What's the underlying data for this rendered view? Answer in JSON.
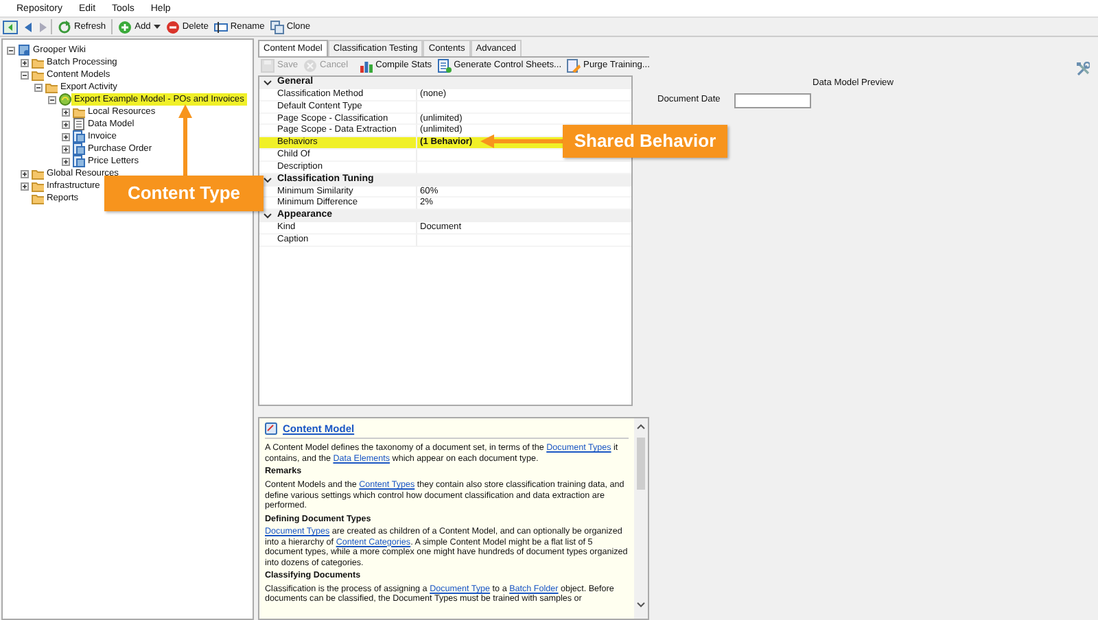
{
  "menu": [
    "Repository",
    "Edit",
    "Tools",
    "Help"
  ],
  "toolbar": [
    {
      "kind": "refresh",
      "label": "Refresh",
      "disabled": false,
      "dropdown": false
    },
    {
      "kind": "add",
      "label": "Add",
      "disabled": false,
      "dropdown": true
    },
    {
      "kind": "delete",
      "label": "Delete",
      "disabled": false,
      "dropdown": false
    },
    {
      "kind": "rename",
      "label": "Rename",
      "disabled": false,
      "dropdown": false
    },
    {
      "kind": "clone",
      "label": "Clone",
      "disabled": false,
      "dropdown": false
    }
  ],
  "tree": [
    {
      "label": "Grooper Wiki",
      "kind": "root",
      "expanded": true,
      "selected": false,
      "highlighted": false,
      "children": [
        {
          "label": "Batch Processing",
          "kind": "folder",
          "expanded": false,
          "selected": false,
          "highlighted": false
        },
        {
          "label": "Content Models",
          "kind": "folder",
          "expanded": true,
          "selected": false,
          "highlighted": false,
          "children": [
            {
              "label": "Export Activity",
              "kind": "folder",
              "expanded": true,
              "selected": false,
              "highlighted": false,
              "children": [
                {
                  "label": "Export Example Model - POs and Invoices",
                  "kind": "model",
                  "expanded": true,
                  "selected": true,
                  "highlighted": true,
                  "children": [
                    {
                      "label": "Local Resources",
                      "kind": "folder",
                      "expanded": false,
                      "selected": false,
                      "highlighted": false
                    },
                    {
                      "label": "Data Model",
                      "kind": "datamodel",
                      "expanded": false,
                      "selected": false,
                      "highlighted": false
                    },
                    {
                      "label": "Invoice",
                      "kind": "doctype",
                      "expanded": false,
                      "selected": false,
                      "highlighted": false
                    },
                    {
                      "label": "Purchase Order",
                      "kind": "doctype",
                      "expanded": false,
                      "selected": false,
                      "highlighted": false
                    },
                    {
                      "label": "Price Letters",
                      "kind": "doctype",
                      "expanded": false,
                      "selected": false,
                      "highlighted": false
                    }
                  ]
                }
              ]
            }
          ]
        },
        {
          "label": "Global Resources",
          "kind": "folder",
          "expanded": false,
          "selected": false,
          "highlighted": false
        },
        {
          "label": "Infrastructure",
          "kind": "folder",
          "expanded": false,
          "selected": false,
          "highlighted": false
        },
        {
          "label": "Reports",
          "kind": "folder",
          "selected": false,
          "highlighted": false
        }
      ]
    }
  ],
  "tabs": [
    {
      "label": "Content Model",
      "selected": true
    },
    {
      "label": "Classification Testing",
      "selected": false
    },
    {
      "label": "Contents",
      "selected": false
    },
    {
      "label": "Advanced",
      "selected": false
    }
  ],
  "editor_toolbar": [
    {
      "kind": "save",
      "label": "Save",
      "disabled": true
    },
    {
      "kind": "cancel",
      "label": "Cancel",
      "disabled": true
    },
    {
      "kind": "stats",
      "label": "Compile Stats",
      "disabled": false
    },
    {
      "kind": "sheets",
      "label": "Generate Control Sheets...",
      "disabled": false
    },
    {
      "kind": "purge",
      "label": "Purge Training...",
      "disabled": false
    }
  ],
  "properties": [
    {
      "section": "General",
      "expanded": true,
      "rows": [
        {
          "name": "Classification Method",
          "value": "(none)",
          "highlighted": false
        },
        {
          "name": "Default Content Type",
          "highlighted": false
        },
        {
          "name": "Page Scope - Classification",
          "value": "(unlimited)",
          "highlighted": false
        },
        {
          "name": "Page Scope - Data Extraction",
          "value": "(unlimited)",
          "highlighted": false
        },
        {
          "name": "Behaviors",
          "value": "(1 Behavior)",
          "highlighted": true
        },
        {
          "name": "Child Of",
          "highlighted": false
        },
        {
          "name": "Description",
          "highlighted": false
        }
      ]
    },
    {
      "section": "Classification Tuning",
      "expanded": true,
      "rows": [
        {
          "name": "Minimum Similarity",
          "value": "60%",
          "highlighted": false
        },
        {
          "name": "Minimum Difference",
          "value": "2%",
          "highlighted": false
        }
      ]
    },
    {
      "section": "Appearance",
      "expanded": true,
      "rows": [
        {
          "name": "Kind",
          "value": "Document",
          "highlighted": false
        },
        {
          "name": "Caption",
          "highlighted": false
        }
      ]
    }
  ],
  "help": {
    "title": "Content Model",
    "blocks": [
      {
        "kind": "text",
        "parts": [
          {
            "text": "A Content Model defines the taxonomy of a document set, in terms of the ",
            "link": false
          },
          {
            "text": "Document Types",
            "link": true
          },
          {
            "text": " it contains, and the ",
            "link": false
          },
          {
            "text": "Data Elements",
            "link": true
          },
          {
            "text": " which appear on each document type.",
            "link": false
          }
        ]
      },
      {
        "kind": "heading",
        "parts": [
          {
            "text": "Remarks",
            "link": false
          }
        ]
      },
      {
        "kind": "text",
        "parts": [
          {
            "text": "Content Models and the ",
            "link": false
          },
          {
            "text": "Content Types",
            "link": true
          },
          {
            "text": " they contain also store classification training data, and define various settings which control how document classification and data extraction are performed.",
            "link": false
          }
        ]
      },
      {
        "kind": "heading",
        "parts": [
          {
            "text": "Defining Document Types",
            "link": false
          }
        ]
      },
      {
        "kind": "text",
        "parts": [
          {
            "text": "Document Types",
            "link": true
          },
          {
            "text": " are created as children of a Content Model, and can optionally be organized into a hierarchy of ",
            "link": false
          },
          {
            "text": "Content Categories",
            "link": true
          },
          {
            "text": ". A simple Content Model might be a flat list of 5 document types, while a more complex one might have hundreds of document types organized into dozens of categories.",
            "link": false
          }
        ]
      },
      {
        "kind": "heading",
        "parts": [
          {
            "text": "Classifying Documents",
            "link": false
          }
        ]
      },
      {
        "kind": "text",
        "parts": [
          {
            "text": "Classification is the process of assigning a ",
            "link": false
          },
          {
            "text": "Document Type",
            "link": true
          },
          {
            "text": " to a ",
            "link": false
          },
          {
            "text": "Batch Folder",
            "link": true
          },
          {
            "text": " object. Before documents can be classified, the Document Types must be trained with samples or",
            "link": false
          }
        ]
      }
    ]
  },
  "preview": {
    "title": "Data Model Preview",
    "fields": [
      {
        "label": "Document Date"
      }
    ]
  },
  "callouts": [
    {
      "text": "Content Type",
      "kind": "up"
    },
    {
      "text": "Shared Behavior",
      "kind": "left"
    }
  ]
}
